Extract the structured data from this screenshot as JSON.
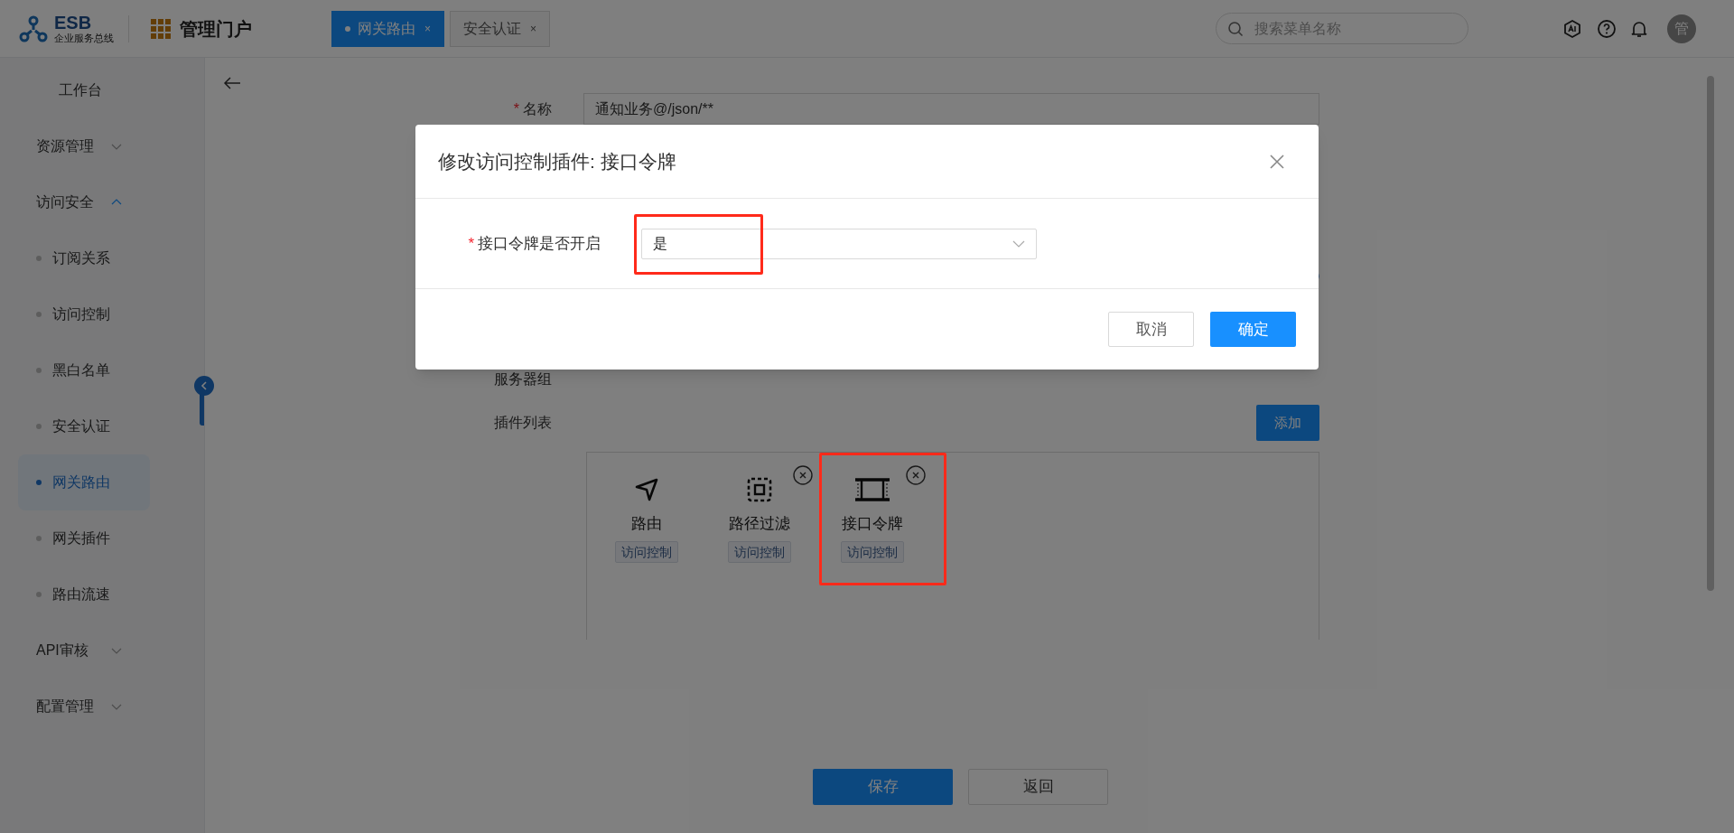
{
  "header": {
    "logo": {
      "title": "ESB",
      "subtitle": "企业服务总线"
    },
    "portal_title": "管理门户",
    "tabs": [
      {
        "label": "网关路由",
        "selected": true,
        "close": "×"
      },
      {
        "label": "安全认证",
        "selected": false,
        "close": "×"
      }
    ],
    "search": {
      "placeholder": "搜索菜单名称"
    },
    "avatar": "管"
  },
  "sidebar": {
    "items": [
      {
        "label": "工作台",
        "selected": false
      },
      {
        "label": "资源管理",
        "expanded": false
      },
      {
        "label": "访问安全",
        "expanded": true,
        "children": [
          {
            "label": "订阅关系",
            "selected": false
          },
          {
            "label": "访问控制",
            "selected": false
          },
          {
            "label": "黑白名单",
            "selected": false
          },
          {
            "label": "安全认证",
            "selected": false
          },
          {
            "label": "网关路由",
            "selected": true
          },
          {
            "label": "网关插件",
            "selected": false
          },
          {
            "label": "路由流速",
            "selected": false
          }
        ]
      },
      {
        "label": "API审核",
        "expanded": false
      },
      {
        "label": "配置管理",
        "expanded": false
      }
    ]
  },
  "form": {
    "name_field": {
      "label": "名称",
      "required_mark": "*",
      "value": "通知业务@/json/**"
    },
    "server_group_label": "服务器组",
    "plugin_list": {
      "label": "插件列表",
      "add_button": "添加",
      "plugins": [
        {
          "kind": "route",
          "name": "路由",
          "tag": "访问控制",
          "removable": false,
          "highlighted": false
        },
        {
          "kind": "filter",
          "name": "路径过滤",
          "tag": "访问控制",
          "removable": true,
          "highlighted": false
        },
        {
          "kind": "token",
          "name": "接口令牌",
          "tag": "访问控制",
          "removable": true,
          "highlighted": true
        }
      ]
    },
    "buttons": [
      {
        "label": "保存",
        "kind": "primary"
      },
      {
        "label": "返回",
        "kind": "default"
      }
    ]
  },
  "modal": {
    "title": "修改访问控制插件: 接口令牌",
    "fields": [
      {
        "label": "接口令牌是否开启",
        "required_mark": "*",
        "value": "是",
        "highlighted": true
      }
    ],
    "buttons": [
      {
        "label": "取消",
        "kind": "default"
      },
      {
        "label": "确定",
        "kind": "primary"
      }
    ]
  }
}
